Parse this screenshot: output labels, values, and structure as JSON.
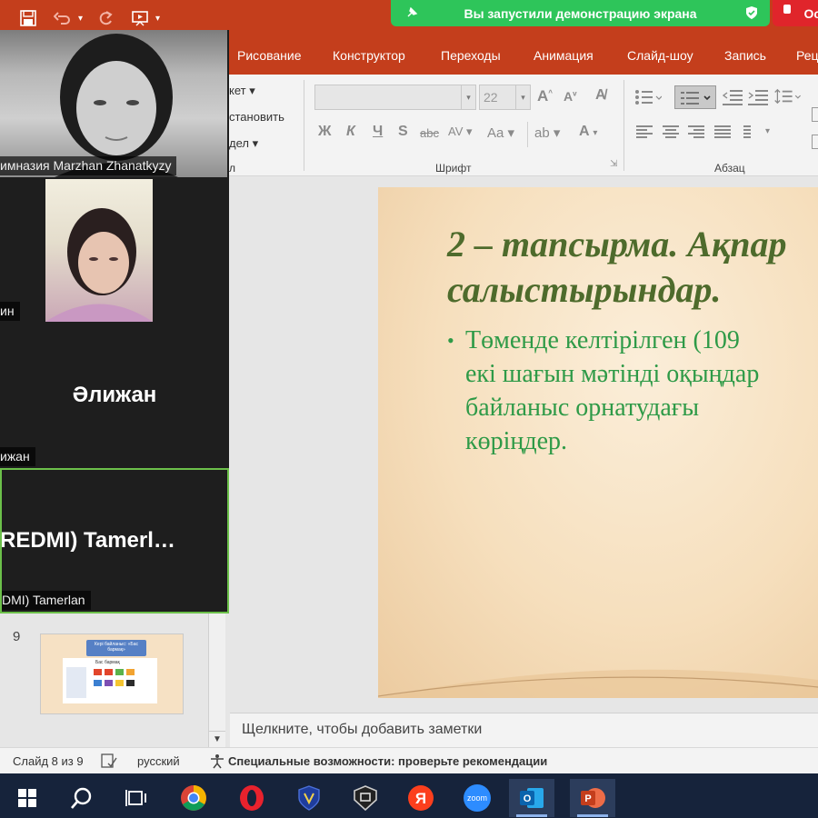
{
  "share_banner": {
    "text": "Вы запустили демонстрацию экрана",
    "stop_label": "Ост"
  },
  "ribbon": {
    "tabs": [
      "Рисование",
      "Конструктор",
      "Переходы",
      "Анимация",
      "Слайд-шоу",
      "Запись",
      "Рец"
    ],
    "clipboard_items": [
      "кет",
      "становить",
      "дел"
    ],
    "font": {
      "name": "",
      "size": "22"
    },
    "groups": {
      "font": "Шрифт",
      "paragraph": "Абзац"
    }
  },
  "participants": [
    {
      "name": "имназия Marzhan Zhanatkyzy"
    },
    {
      "name": "ин"
    },
    {
      "display": "Әлижан",
      "name": "ижан"
    },
    {
      "display": "REDMI)  Tamerl…",
      "name": "DMI) Tamerlan"
    }
  ],
  "thumbnails": [
    {
      "number": "9",
      "title": "Кері байланыс: «Бас бармақ»",
      "heading": "Бас бармақ"
    }
  ],
  "slide": {
    "title_line1": "2 – тапсырма. Ақпар",
    "title_line2": "салыстырындар.",
    "bullet": "•",
    "body_lines": [
      "Төменде  келтірілген  (109",
      "екі шағын мәтінді оқыңдар",
      "байланыс     орнатудағы",
      "көріңдер."
    ]
  },
  "notes": {
    "placeholder": "Щелкните, чтобы добавить заметки"
  },
  "status": {
    "slide_counter": "Слайд 8 из 9",
    "language": "русский",
    "accessibility": "Специальные возможности: проверьте рекомендации"
  },
  "taskbar": {
    "apps": [
      "windows-start",
      "search",
      "task-view",
      "chrome",
      "opera",
      "app-shield",
      "app-monitor",
      "yandex",
      "zoom",
      "outlook",
      "powerpoint"
    ],
    "zoom_label": "zoom",
    "yandex_label": "Я"
  },
  "colors": {
    "powerpoint_red": "#c43e1c",
    "banner_green": "#2ec55a",
    "stop_red": "#e0252b",
    "slide_title": "#4e6b2c",
    "slide_body": "#2e9a47"
  }
}
